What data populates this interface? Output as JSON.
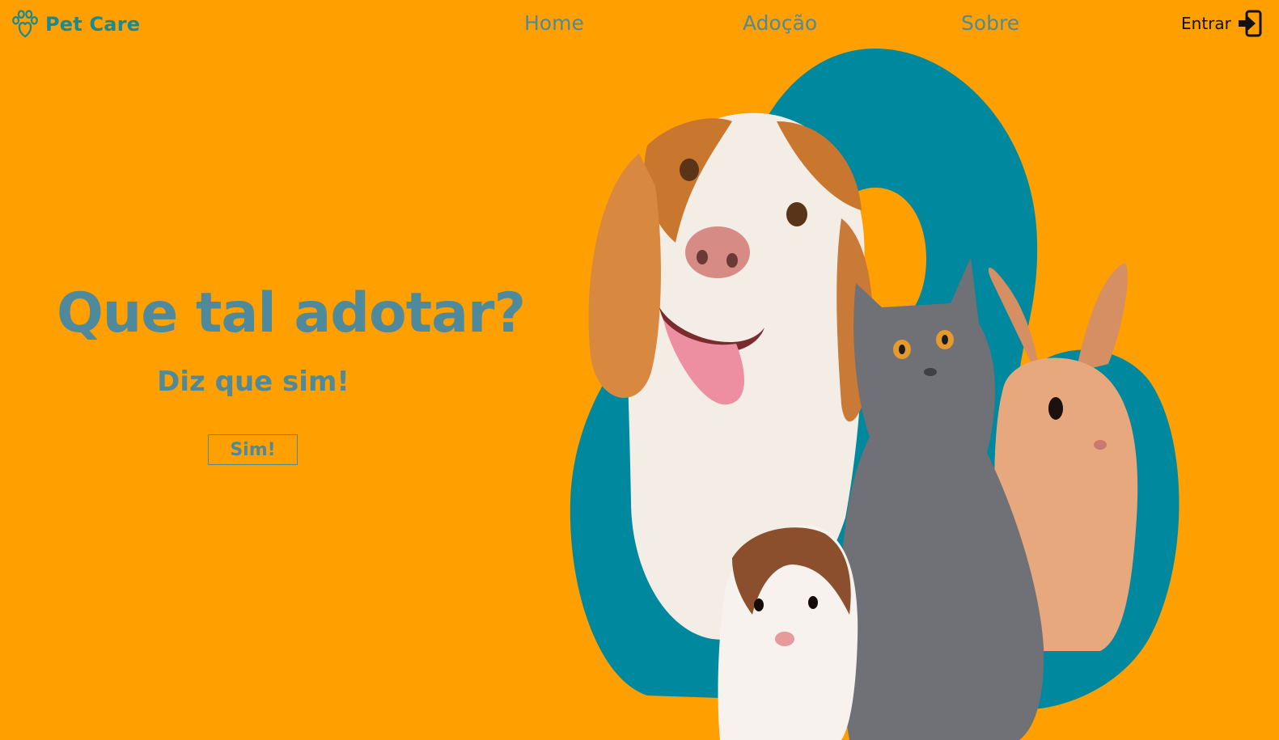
{
  "header": {
    "brand": "Pet Care",
    "logo_icon": "paw-heart-icon",
    "nav": [
      {
        "label": "Home"
      },
      {
        "label": "Adoção"
      },
      {
        "label": "Sobre"
      }
    ],
    "login_label": "Entrar",
    "login_icon": "sign-in-icon"
  },
  "hero": {
    "title": "Que tal adotar?",
    "subtitle": "Diz que sim!",
    "cta_label": "Sim!",
    "image": "dog-cat-rabbit-guinea-pig-photo"
  },
  "colors": {
    "background": "#FF9F00",
    "brand_teal": "#1A8A92",
    "muted_teal": "#4F8A9C",
    "blob_teal": "#00889E"
  }
}
